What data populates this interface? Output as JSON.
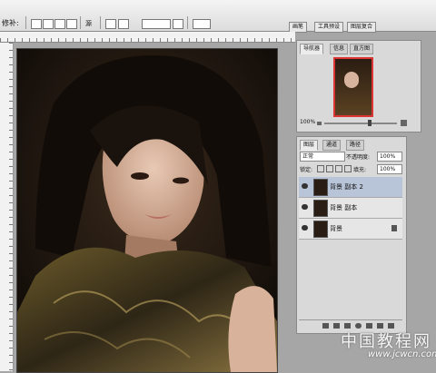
{
  "toolbar": {
    "tool_label": "修补:",
    "option_label": "源"
  },
  "top_tabs": [
    "画笔",
    "工具预设",
    "图层复合"
  ],
  "navigator": {
    "tabs": [
      "导航器",
      "信息",
      "直方图"
    ],
    "zoom": "100%"
  },
  "layers": {
    "tabs": [
      "图层",
      "通道",
      "路径"
    ],
    "blend_mode": "正常",
    "opacity_label": "不透明度:",
    "opacity_value": "100%",
    "lock_label": "锁定:",
    "fill_label": "填充:",
    "fill_value": "100%",
    "items": [
      {
        "name": "背景 副本 2",
        "selected": true
      },
      {
        "name": "背景 副本",
        "selected": false
      },
      {
        "name": "背景",
        "selected": false
      }
    ]
  },
  "watermark": {
    "site_cn": "中国教程网",
    "site_url": "www.jcwcn.com"
  },
  "colors": {
    "panel_bg": "#d9d9d9",
    "selection": "#b8c4d8",
    "workspace": "#a6a6a6"
  }
}
